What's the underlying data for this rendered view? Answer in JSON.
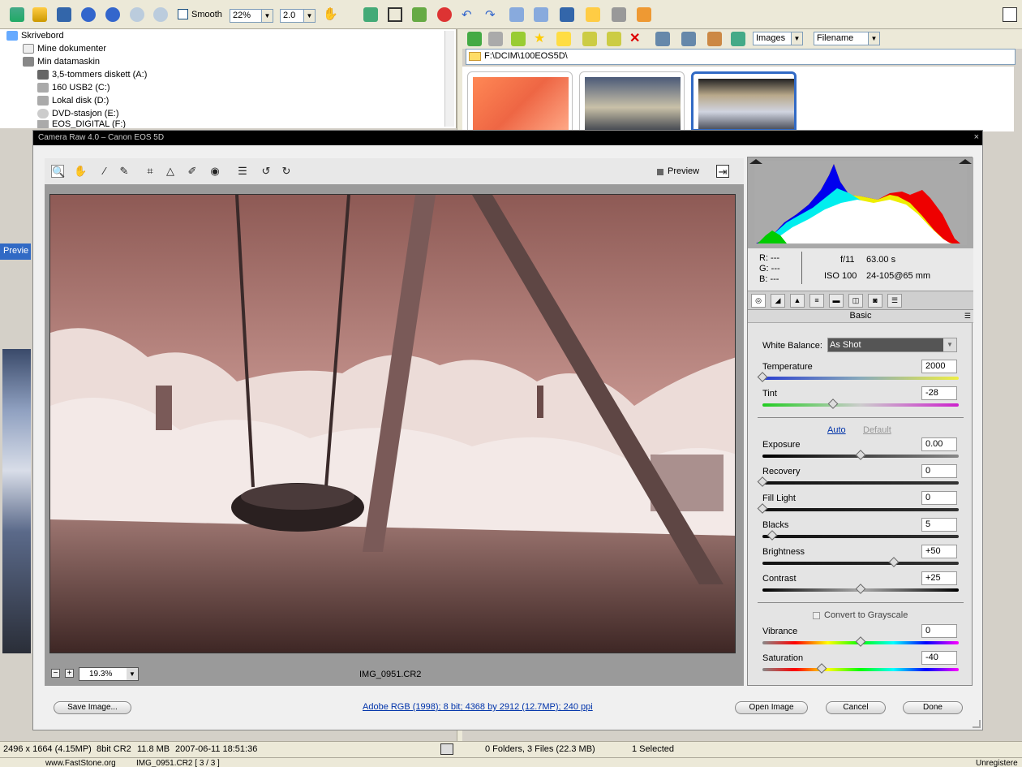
{
  "toolbar": {
    "smooth_label": "Smooth",
    "zoom_value": "22%",
    "ratio_value": "2.0",
    "filter_value": "Images",
    "sort_value": "Filename"
  },
  "tree": {
    "items": [
      {
        "label": "Skrivebord",
        "icon": "desktop-icon"
      },
      {
        "label": "Mine dokumenter",
        "icon": "documents-icon"
      },
      {
        "label": "Min datamaskin",
        "icon": "computer-icon"
      },
      {
        "label": "3,5-tommers diskett (A:)",
        "icon": "floppy-icon"
      },
      {
        "label": "160 USB2 (C:)",
        "icon": "drive-icon"
      },
      {
        "label": "Lokal disk (D:)",
        "icon": "drive-icon"
      },
      {
        "label": "DVD-stasjon (E:)",
        "icon": "dvd-icon"
      },
      {
        "label": "EOS_DIGITAL (F:)",
        "icon": "drive-icon"
      }
    ]
  },
  "browser": {
    "path": "F:\\DCIM\\100EOS5D\\"
  },
  "side": {
    "preview_tab": "Previe"
  },
  "camera_raw": {
    "title": "Camera Raw 4.0  –  Canon EOS 5D",
    "preview_label": "Preview",
    "zoom": "19.3%",
    "filename": "IMG_0951.CR2",
    "readout": {
      "r": "R:  ---",
      "g": "G:  ---",
      "b": "B:  ---",
      "aperture": "f/11",
      "shutter": "63.00 s",
      "iso": "ISO 100",
      "lens": "24-105@65 mm"
    },
    "panel_title": "Basic",
    "white_balance_label": "White Balance:",
    "white_balance_value": "As Shot",
    "auto_label": "Auto",
    "default_label": "Default",
    "grayscale_label": "Convert to Grayscale",
    "sliders": [
      {
        "label": "Temperature",
        "value": "2000",
        "pos": 0.0,
        "track": "temp"
      },
      {
        "label": "Tint",
        "value": "-28",
        "pos": 0.36,
        "track": "tint"
      },
      {
        "label": "Exposure",
        "value": "0.00",
        "pos": 0.5,
        "track": "exp"
      },
      {
        "label": "Recovery",
        "value": "0",
        "pos": 0.0,
        "track": "dark"
      },
      {
        "label": "Fill Light",
        "value": "0",
        "pos": 0.0,
        "track": "dark"
      },
      {
        "label": "Blacks",
        "value": "5",
        "pos": 0.05,
        "track": "dark"
      },
      {
        "label": "Brightness",
        "value": "+50",
        "pos": 0.67,
        "track": "dark"
      },
      {
        "label": "Contrast",
        "value": "+25",
        "pos": 0.5,
        "track": "contrast"
      },
      {
        "label": "Vibrance",
        "value": "0",
        "pos": 0.5,
        "track": "vib"
      },
      {
        "label": "Saturation",
        "value": "-40",
        "pos": 0.3,
        "track": "sat"
      }
    ],
    "save_label": "Save Image...",
    "workflow_link": "Adobe RGB (1998); 8 bit; 4368 by 2912 (12.7MP); 240 ppi",
    "open_label": "Open Image",
    "cancel_label": "Cancel",
    "done_label": "Done"
  },
  "status": {
    "dims": "2496 x 1664 (4.15MP)",
    "type": "8bit CR2",
    "size": "11.8 MB",
    "date": "2007-06-11 18:51:36",
    "folders": "0 Folders, 3 Files (22.3 MB)",
    "selected": "1 Selected",
    "site": "www.FastStone.org",
    "file_info": "IMG_0951.CR2 [ 3 / 3 ]",
    "reg": "Unregistere"
  }
}
